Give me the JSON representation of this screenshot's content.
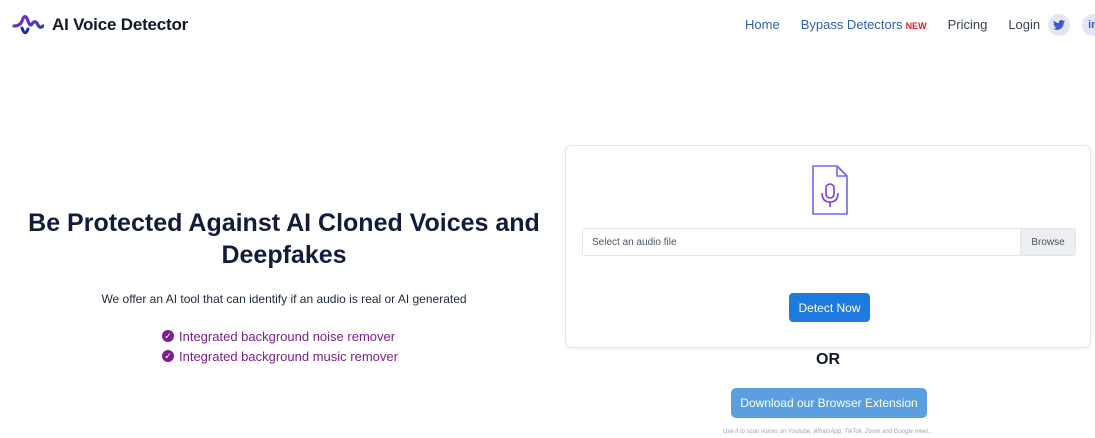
{
  "brand": {
    "name": "AI Voice Detector"
  },
  "nav": {
    "home": "Home",
    "bypass": "Bypass Detectors",
    "bypass_badge": "NEW",
    "pricing": "Pricing",
    "login": "Login",
    "social": [
      {
        "icon": "twitter-icon",
        "glyph": "🐦"
      },
      {
        "icon": "linkedin-icon",
        "glyph": "in"
      }
    ]
  },
  "hero": {
    "title_line1": "Be Protected Against AI Cloned Voices and",
    "title_line2": "Deepfakes",
    "subtitle": "We offer an AI tool that can identify if an audio is real or AI generated",
    "features": [
      "Integrated background noise remover",
      "Integrated background music remover"
    ]
  },
  "upload": {
    "icon": "audio-file-icon",
    "placeholder": "Select an audio file",
    "browse": "Browse",
    "detect": "Detect Now"
  },
  "or_text": "OR",
  "extension": {
    "button": "Download our Browser Extension",
    "note": "Use it to scan voices on Youtube, WhatsApp, TikTok, Zoom and Google meet..."
  },
  "colors": {
    "nav_link": "#2f5fb3",
    "new_badge": "#e11d2a",
    "feature": "#7c1f8c",
    "detect_button": "#1f7ae0",
    "extension_button": "#5a9fe0"
  }
}
